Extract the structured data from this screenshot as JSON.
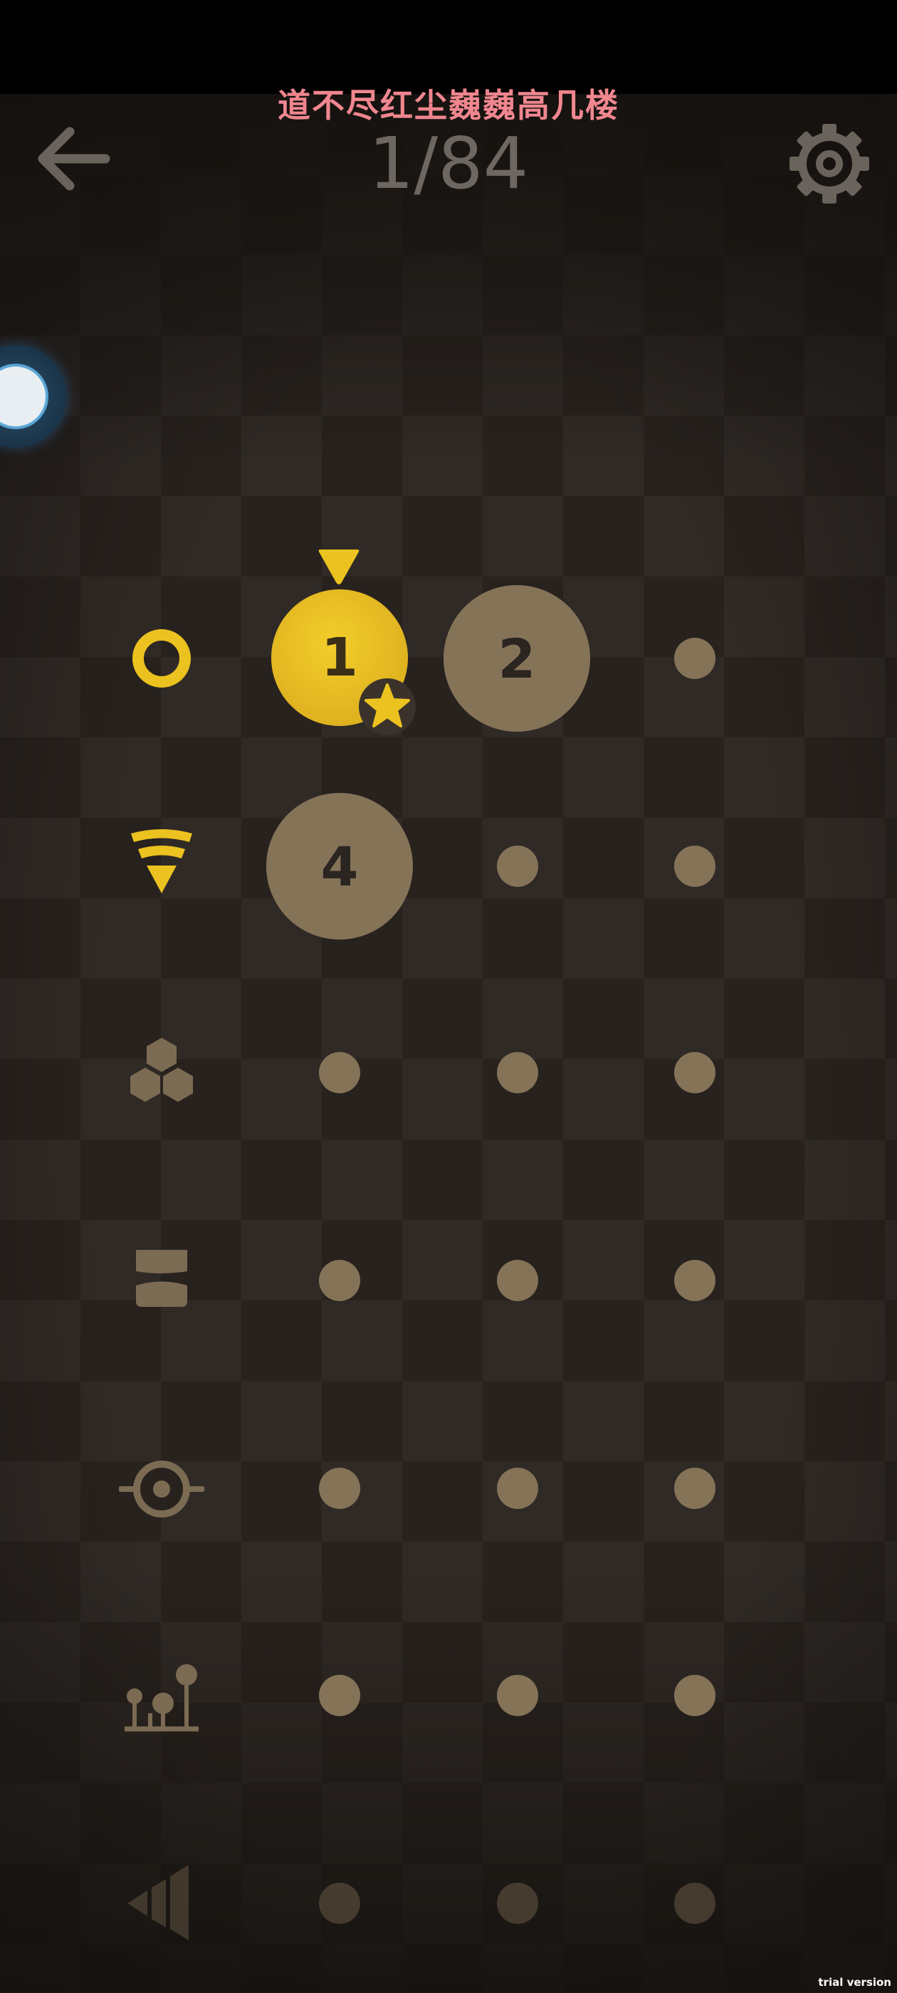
{
  "overlay_title": "道不尽红尘巍巍高几楼",
  "progress": {
    "label": "1/84",
    "completed": 1,
    "total": 84
  },
  "icons": {
    "back": "arrow-left-icon",
    "settings": "gear-icon",
    "floating_tool": "circle-tool-icon"
  },
  "categories": [
    {
      "icon": "ring-icon",
      "active": true
    },
    {
      "icon": "signal-funnel-icon",
      "active": true
    },
    {
      "icon": "hexagons-icon",
      "active": false
    },
    {
      "icon": "blocks-icon",
      "active": false
    },
    {
      "icon": "target-icon",
      "active": false
    },
    {
      "icon": "tree-chart-icon",
      "active": false
    },
    {
      "icon": "bars-triangle-icon",
      "active": false
    }
  ],
  "levels": {
    "level_1": {
      "number": "1",
      "state": "completed",
      "starred": true,
      "current": true
    },
    "level_2": {
      "number": "2",
      "state": "unlocked"
    },
    "level_4": {
      "number": "4",
      "state": "unlocked"
    }
  },
  "colors": {
    "gold": "#ebc21f",
    "node": "#857358",
    "overlay_title": "#f0868f",
    "background": "#28221e"
  },
  "watermark": "trial version"
}
